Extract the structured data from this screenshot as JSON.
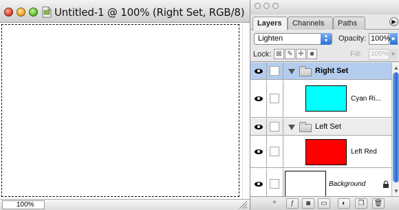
{
  "document": {
    "title": "Untitled-1 @ 100% (Right Set, RGB/8)",
    "zoom": "100%"
  },
  "palette": {
    "tabs": [
      {
        "label": "Layers",
        "active": true
      },
      {
        "label": "Channels",
        "active": false
      },
      {
        "label": "Paths",
        "active": false
      }
    ],
    "blend_mode": "Lighten",
    "opacity_label": "Opacity:",
    "opacity_value": "100%",
    "lock_label": "Lock:",
    "fill_label": "Fill:",
    "fill_value": "100%",
    "layers": [
      {
        "type": "group",
        "name": "Right Set",
        "selected": true,
        "visible": true,
        "expanded": true
      },
      {
        "type": "layer",
        "name": "Cyan Ri...",
        "color": "#00ffff",
        "visible": true
      },
      {
        "type": "group",
        "name": "Left Set",
        "selected": false,
        "visible": true,
        "expanded": true
      },
      {
        "type": "layer",
        "name": "Left Red",
        "color": "#ff0000",
        "visible": true
      },
      {
        "type": "layer",
        "name": "Background",
        "color": "#ffffff",
        "visible": true,
        "locked": true
      }
    ],
    "toolbar_icons": [
      "link-layers-icon",
      "layer-style-icon",
      "add-mask-icon",
      "new-group-icon",
      "adjustment-layer-icon",
      "new-layer-icon",
      "trash-icon"
    ]
  },
  "colors": {
    "selection": "#b4cdee",
    "scroll_accent": "#2a66cf"
  }
}
